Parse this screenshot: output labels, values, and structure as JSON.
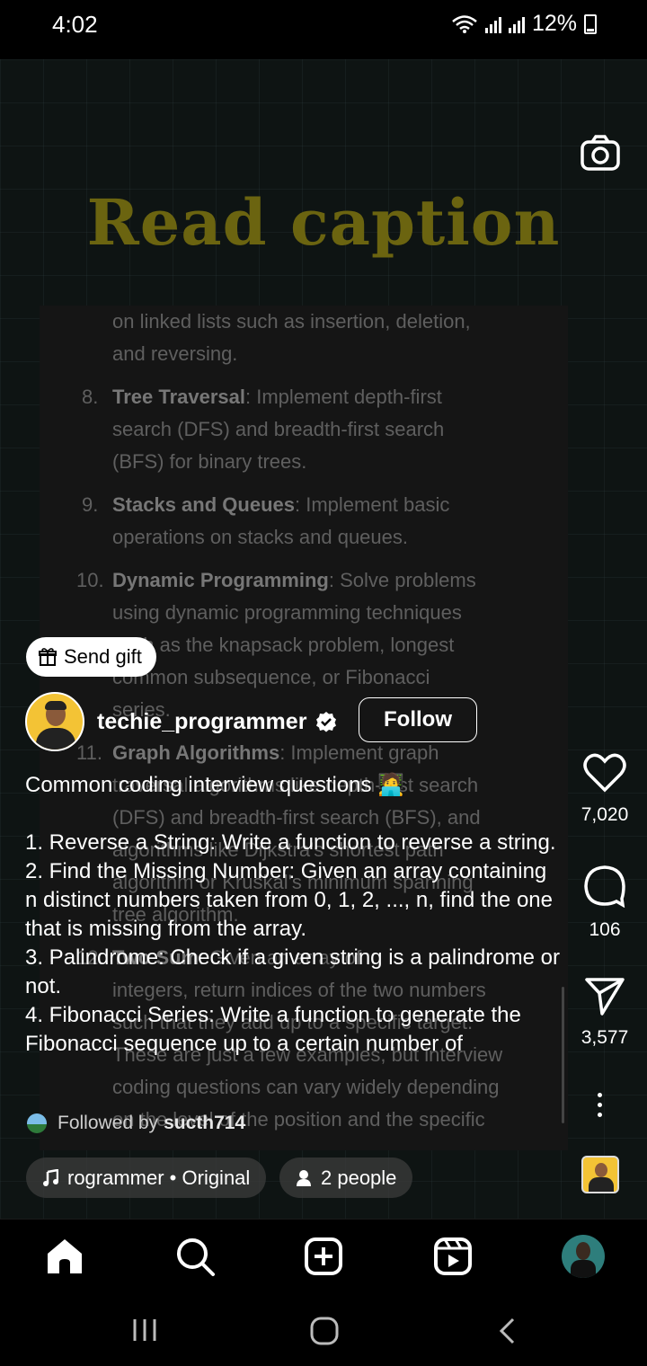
{
  "status_bar": {
    "time": "4:02",
    "battery": "12%"
  },
  "reel": {
    "title": "Read caption",
    "doc_lines": [
      {
        "num": "",
        "bold": "",
        "text": "on linked lists such as insertion, deletion,"
      },
      {
        "num": "",
        "bold": "",
        "text": "and reversing."
      },
      {
        "num": "8.",
        "bold": "Tree Traversal",
        "text": ": Implement depth-first"
      },
      {
        "num": "",
        "bold": "",
        "text": "search (DFS) and breadth-first search"
      },
      {
        "num": "",
        "bold": "",
        "text": "(BFS) for binary trees."
      },
      {
        "num": "9.",
        "bold": "Stacks and Queues",
        "text": ": Implement basic"
      },
      {
        "num": "",
        "bold": "",
        "text": "operations on stacks and queues."
      },
      {
        "num": "10.",
        "bold": "Dynamic Programming",
        "text": ": Solve problems"
      },
      {
        "num": "",
        "bold": "",
        "text": "using dynamic programming techniques"
      },
      {
        "num": "",
        "bold": "",
        "text": "such as the knapsack problem, longest"
      },
      {
        "num": "",
        "bold": "",
        "text": "common subsequence, or Fibonacci"
      },
      {
        "num": "",
        "bold": "",
        "text": "series."
      },
      {
        "num": "11.",
        "bold": "Graph Algorithms",
        "text": ": Implement graph"
      },
      {
        "num": "",
        "bold": "",
        "text": "traversal algorithms like depth-first search"
      },
      {
        "num": "",
        "bold": "",
        "text": "(DFS) and breadth-first search (BFS), and"
      },
      {
        "num": "",
        "bold": "",
        "text": "algorithms like Dijkstra's shortest path"
      },
      {
        "num": "",
        "bold": "",
        "text": "algorithm or Kruskal's minimum spanning"
      },
      {
        "num": "",
        "bold": "",
        "text": "tree algorithm."
      },
      {
        "num": "12.",
        "bold": "Two Sum",
        "text": ": Given an array of"
      },
      {
        "num": "",
        "bold": "",
        "text": "integers, return indices of the two numbers"
      },
      {
        "num": "",
        "bold": "",
        "text": "such that they add up to a specific target."
      },
      {
        "num": "",
        "bold": "",
        "text": "These are just a few examples, but interview"
      },
      {
        "num": "",
        "bold": "",
        "text": "coding questions can vary widely depending"
      },
      {
        "num": "",
        "bold": "",
        "text": "on the level of the position and the specific"
      }
    ]
  },
  "overlay": {
    "gift_label": "Send gift",
    "username": "techie_programmer",
    "follow_label": "Follow",
    "caption_head": "Common coding interview questions 🧑‍💻",
    "caption_lines": [
      "1. Reverse a String: Write a function to reverse a string.",
      "2. Find the Missing Number: Given an array containing n distinct numbers taken from 0, 1, 2, ..., n, find the one that is missing from the array.",
      "3. Palindrome: Check if a given string is a palindrome or not.",
      "4. Fibonacci Series: Write a function to generate the Fibonacci sequence up to a certain number of"
    ],
    "followed_by_prefix": "Followed by",
    "followed_by_user": "sucth714",
    "audio_label": "rogrammer • Original",
    "people_label": "2 people"
  },
  "actions": {
    "likes": "7,020",
    "comments": "106",
    "shares": "3,577"
  }
}
